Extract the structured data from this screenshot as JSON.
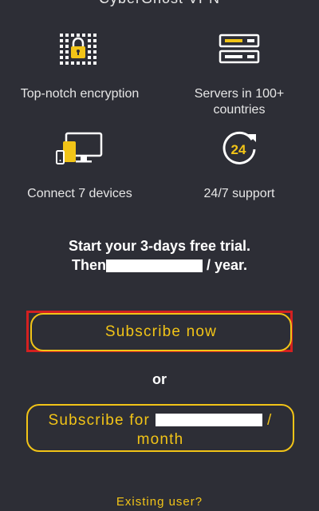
{
  "app": {
    "title": "CyberGhost VPN"
  },
  "features": [
    {
      "icon": "padlock-grid-icon",
      "label_lines": [
        "Top-notch encryption"
      ]
    },
    {
      "icon": "servers-icon",
      "label_lines": [
        "Servers in 100+",
        "countries"
      ]
    },
    {
      "icon": "devices-icon",
      "label_lines": [
        "Connect 7 devices"
      ]
    },
    {
      "icon": "support-24-icon",
      "label_lines": [
        "24/7 support"
      ],
      "icon_text": "24"
    }
  ],
  "trial": {
    "line1": "Start your 3-days free trial.",
    "line2_prefix": "Then",
    "line2_suffix": " / year."
  },
  "buttons": {
    "subscribe_now": "Subscribe now",
    "subscribe_monthly_prefix": "Subscribe for",
    "subscribe_monthly_suffix": " /",
    "subscribe_monthly_line2": "month"
  },
  "divider_text": "or",
  "existing_user": "Existing user?",
  "colors": {
    "background": "#2d2e36",
    "accent": "#f2c417",
    "highlight_frame": "#d42020"
  }
}
